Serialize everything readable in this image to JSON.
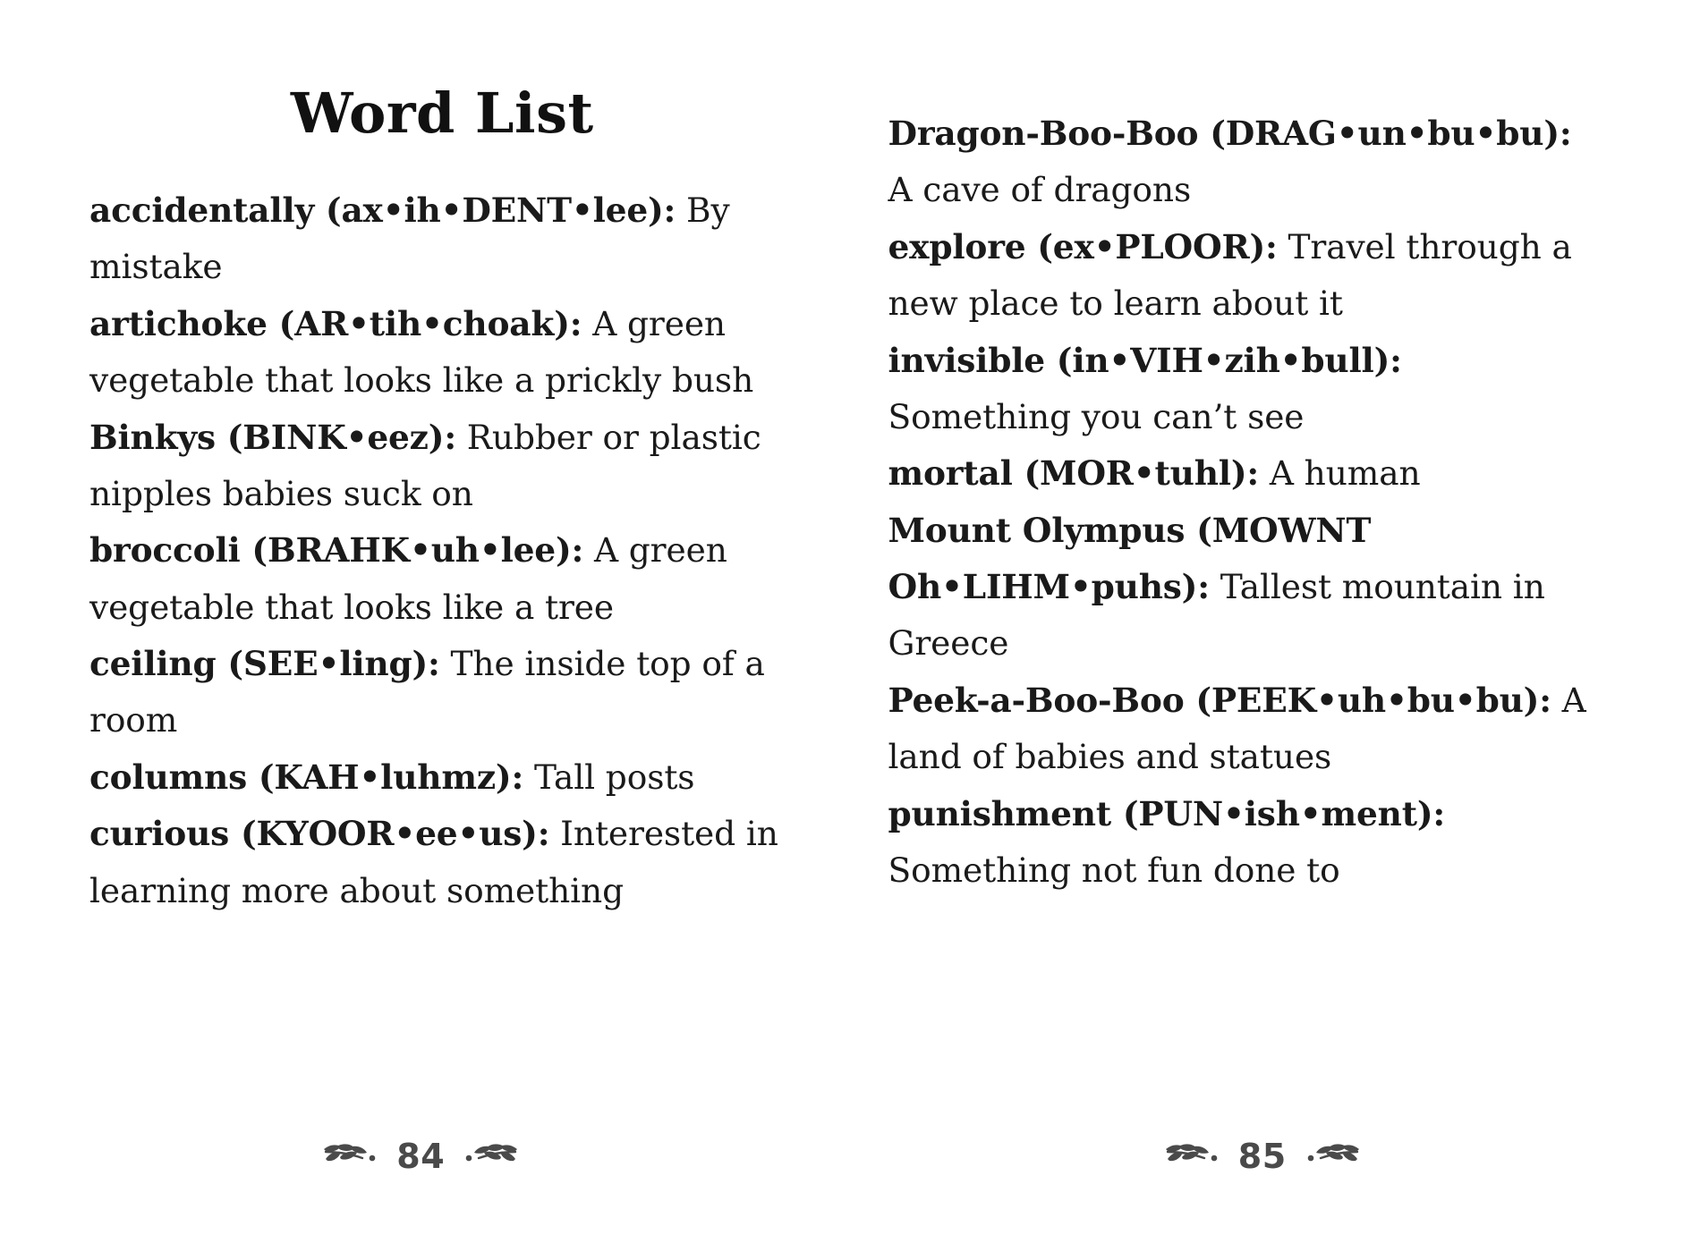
{
  "spread": {
    "background_color": "#ffffff",
    "text_color": "#111111",
    "ornament_color": "#4a4a4a"
  },
  "left_page": {
    "title": "Word List",
    "page_number": "84",
    "entries": [
      {
        "term": "accidentally (ax•ih•DENT•lee):",
        "definition": " By mistake"
      },
      {
        "term": "artichoke (AR•tih•choak):",
        "definition": " A green vegetable that looks like a prickly bush"
      },
      {
        "term": "Binkys (BINK•eez):",
        "definition": " Rubber or plastic nipples babies suck on"
      },
      {
        "term": "broccoli (BRAHK•uh•lee):",
        "definition": " A green vegetable that looks like a tree"
      },
      {
        "term": "ceiling (SEE•ling):",
        "definition": " The inside top of a room"
      },
      {
        "term": "columns (KAH•luhmz):",
        "definition": " Tall posts"
      },
      {
        "term": "curious (KYOOR•ee•us):",
        "definition": " Interested in learning more about something"
      }
    ]
  },
  "right_page": {
    "page_number": "85",
    "entries": [
      {
        "term": "Dragon-Boo-Boo (DRAG•un•bu•bu):",
        "definition": " A cave of dragons"
      },
      {
        "term": "explore (ex•PLOOR):",
        "definition": " Travel through a new place to learn about it"
      },
      {
        "term": "invisible (in•VIH•zih•bull):",
        "definition": " Something you can’t see"
      },
      {
        "term": "mortal (MOR•tuhl):",
        "definition": " A human"
      },
      {
        "term": "Mount Olympus (MOWNT Oh•LIHM•puhs):",
        "definition": " Tallest mountain in Greece"
      },
      {
        "term": "Peek-a-Boo-Boo (PEEK•uh•bu•bu):",
        "definition": " A land of babies and statues"
      },
      {
        "term": "punishment (PUN•ish•ment):",
        "definition": " Something not fun done to"
      }
    ]
  },
  "icons": {
    "ornament": "leafy-branch-ornament"
  }
}
